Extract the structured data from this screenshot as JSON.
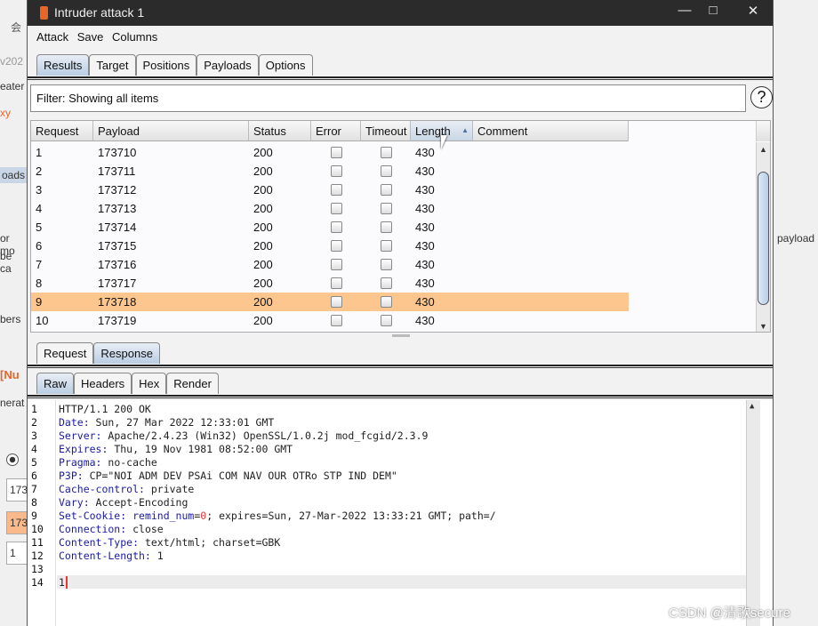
{
  "background": {
    "fragments": [
      "会",
      "v202",
      "eater",
      "xy",
      "oads",
      "or mo",
      "be ca",
      "bers",
      "[Nu",
      "nerat",
      "173",
      "173",
      "1",
      "payload"
    ]
  },
  "window": {
    "title": "Intruder attack 1",
    "controls": [
      "minimize",
      "maximize",
      "close"
    ]
  },
  "menu": [
    "Attack",
    "Save",
    "Columns"
  ],
  "tabs": [
    {
      "label": "Results",
      "active": true
    },
    {
      "label": "Target"
    },
    {
      "label": "Positions"
    },
    {
      "label": "Payloads"
    },
    {
      "label": "Options"
    }
  ],
  "filter": {
    "text": "Filter: Showing all items",
    "help": "?"
  },
  "table": {
    "columns": [
      "Request",
      "Payload",
      "Status",
      "Error",
      "Timeout",
      "Length",
      "Comment"
    ],
    "sorted_column": "Length",
    "sort_direction": "ascending",
    "rows": [
      {
        "request": "1",
        "payload": "173710",
        "status": "200",
        "error": false,
        "timeout": false,
        "length": "430",
        "comment": ""
      },
      {
        "request": "2",
        "payload": "173711",
        "status": "200",
        "error": false,
        "timeout": false,
        "length": "430",
        "comment": ""
      },
      {
        "request": "3",
        "payload": "173712",
        "status": "200",
        "error": false,
        "timeout": false,
        "length": "430",
        "comment": ""
      },
      {
        "request": "4",
        "payload": "173713",
        "status": "200",
        "error": false,
        "timeout": false,
        "length": "430",
        "comment": ""
      },
      {
        "request": "5",
        "payload": "173714",
        "status": "200",
        "error": false,
        "timeout": false,
        "length": "430",
        "comment": ""
      },
      {
        "request": "6",
        "payload": "173715",
        "status": "200",
        "error": false,
        "timeout": false,
        "length": "430",
        "comment": ""
      },
      {
        "request": "7",
        "payload": "173716",
        "status": "200",
        "error": false,
        "timeout": false,
        "length": "430",
        "comment": ""
      },
      {
        "request": "8",
        "payload": "173717",
        "status": "200",
        "error": false,
        "timeout": false,
        "length": "430",
        "comment": ""
      },
      {
        "request": "9",
        "payload": "173718",
        "status": "200",
        "error": false,
        "timeout": false,
        "length": "430",
        "comment": "",
        "selected": true
      },
      {
        "request": "10",
        "payload": "173719",
        "status": "200",
        "error": false,
        "timeout": false,
        "length": "430",
        "comment": ""
      }
    ]
  },
  "message_tabs": [
    {
      "label": "Request"
    },
    {
      "label": "Response",
      "active": true
    }
  ],
  "view_tabs": [
    {
      "label": "Raw",
      "active": true
    },
    {
      "label": "Headers"
    },
    {
      "label": "Hex"
    },
    {
      "label": "Render"
    }
  ],
  "response_lines": [
    {
      "n": "1",
      "key": "",
      "val": "HTTP/1.1 200 OK"
    },
    {
      "n": "2",
      "key": "Date:",
      "val": " Sun, 27 Mar 2022 12:33:01 GMT"
    },
    {
      "n": "3",
      "key": "Server:",
      "val": " Apache/2.4.23 (Win32) OpenSSL/1.0.2j mod_fcgid/2.3.9"
    },
    {
      "n": "4",
      "key": "Expires:",
      "val": " Thu, 19 Nov 1981 08:52:00 GMT"
    },
    {
      "n": "5",
      "key": "Pragma:",
      "val": " no-cache"
    },
    {
      "n": "6",
      "key": "P3P:",
      "val": " CP=\"NOI ADM DEV PSAi COM NAV OUR OTRo STP IND DEM\""
    },
    {
      "n": "7",
      "key": "Cache-control:",
      "val": " private"
    },
    {
      "n": "8",
      "key": "Vary:",
      "val": " Accept-Encoding"
    },
    {
      "n": "9",
      "key": "Set-Cookie:",
      "val": "",
      "cookie_name": " remind_num",
      "cookie_eq": "=",
      "cookie_val": "0",
      "cookie_rest": "; expires=Sun, 27-Mar-2022 13:33:21 GMT; path=/"
    },
    {
      "n": "10",
      "key": "Connection:",
      "val": " close"
    },
    {
      "n": "11",
      "key": "Content-Type:",
      "val": " text/html; charset=GBK"
    },
    {
      "n": "12",
      "key": "Content-Length:",
      "val": " 1"
    },
    {
      "n": "13",
      "key": "",
      "val": ""
    },
    {
      "n": "14",
      "key": "",
      "val": "1",
      "current": true
    }
  ],
  "watermark": "CSDN @清歌secure",
  "colors": {
    "selected_row": "#fdc68e",
    "title_bar": "#2b2b2b",
    "header_key": "#1a1aa6",
    "cookie_value": "#e33333"
  }
}
